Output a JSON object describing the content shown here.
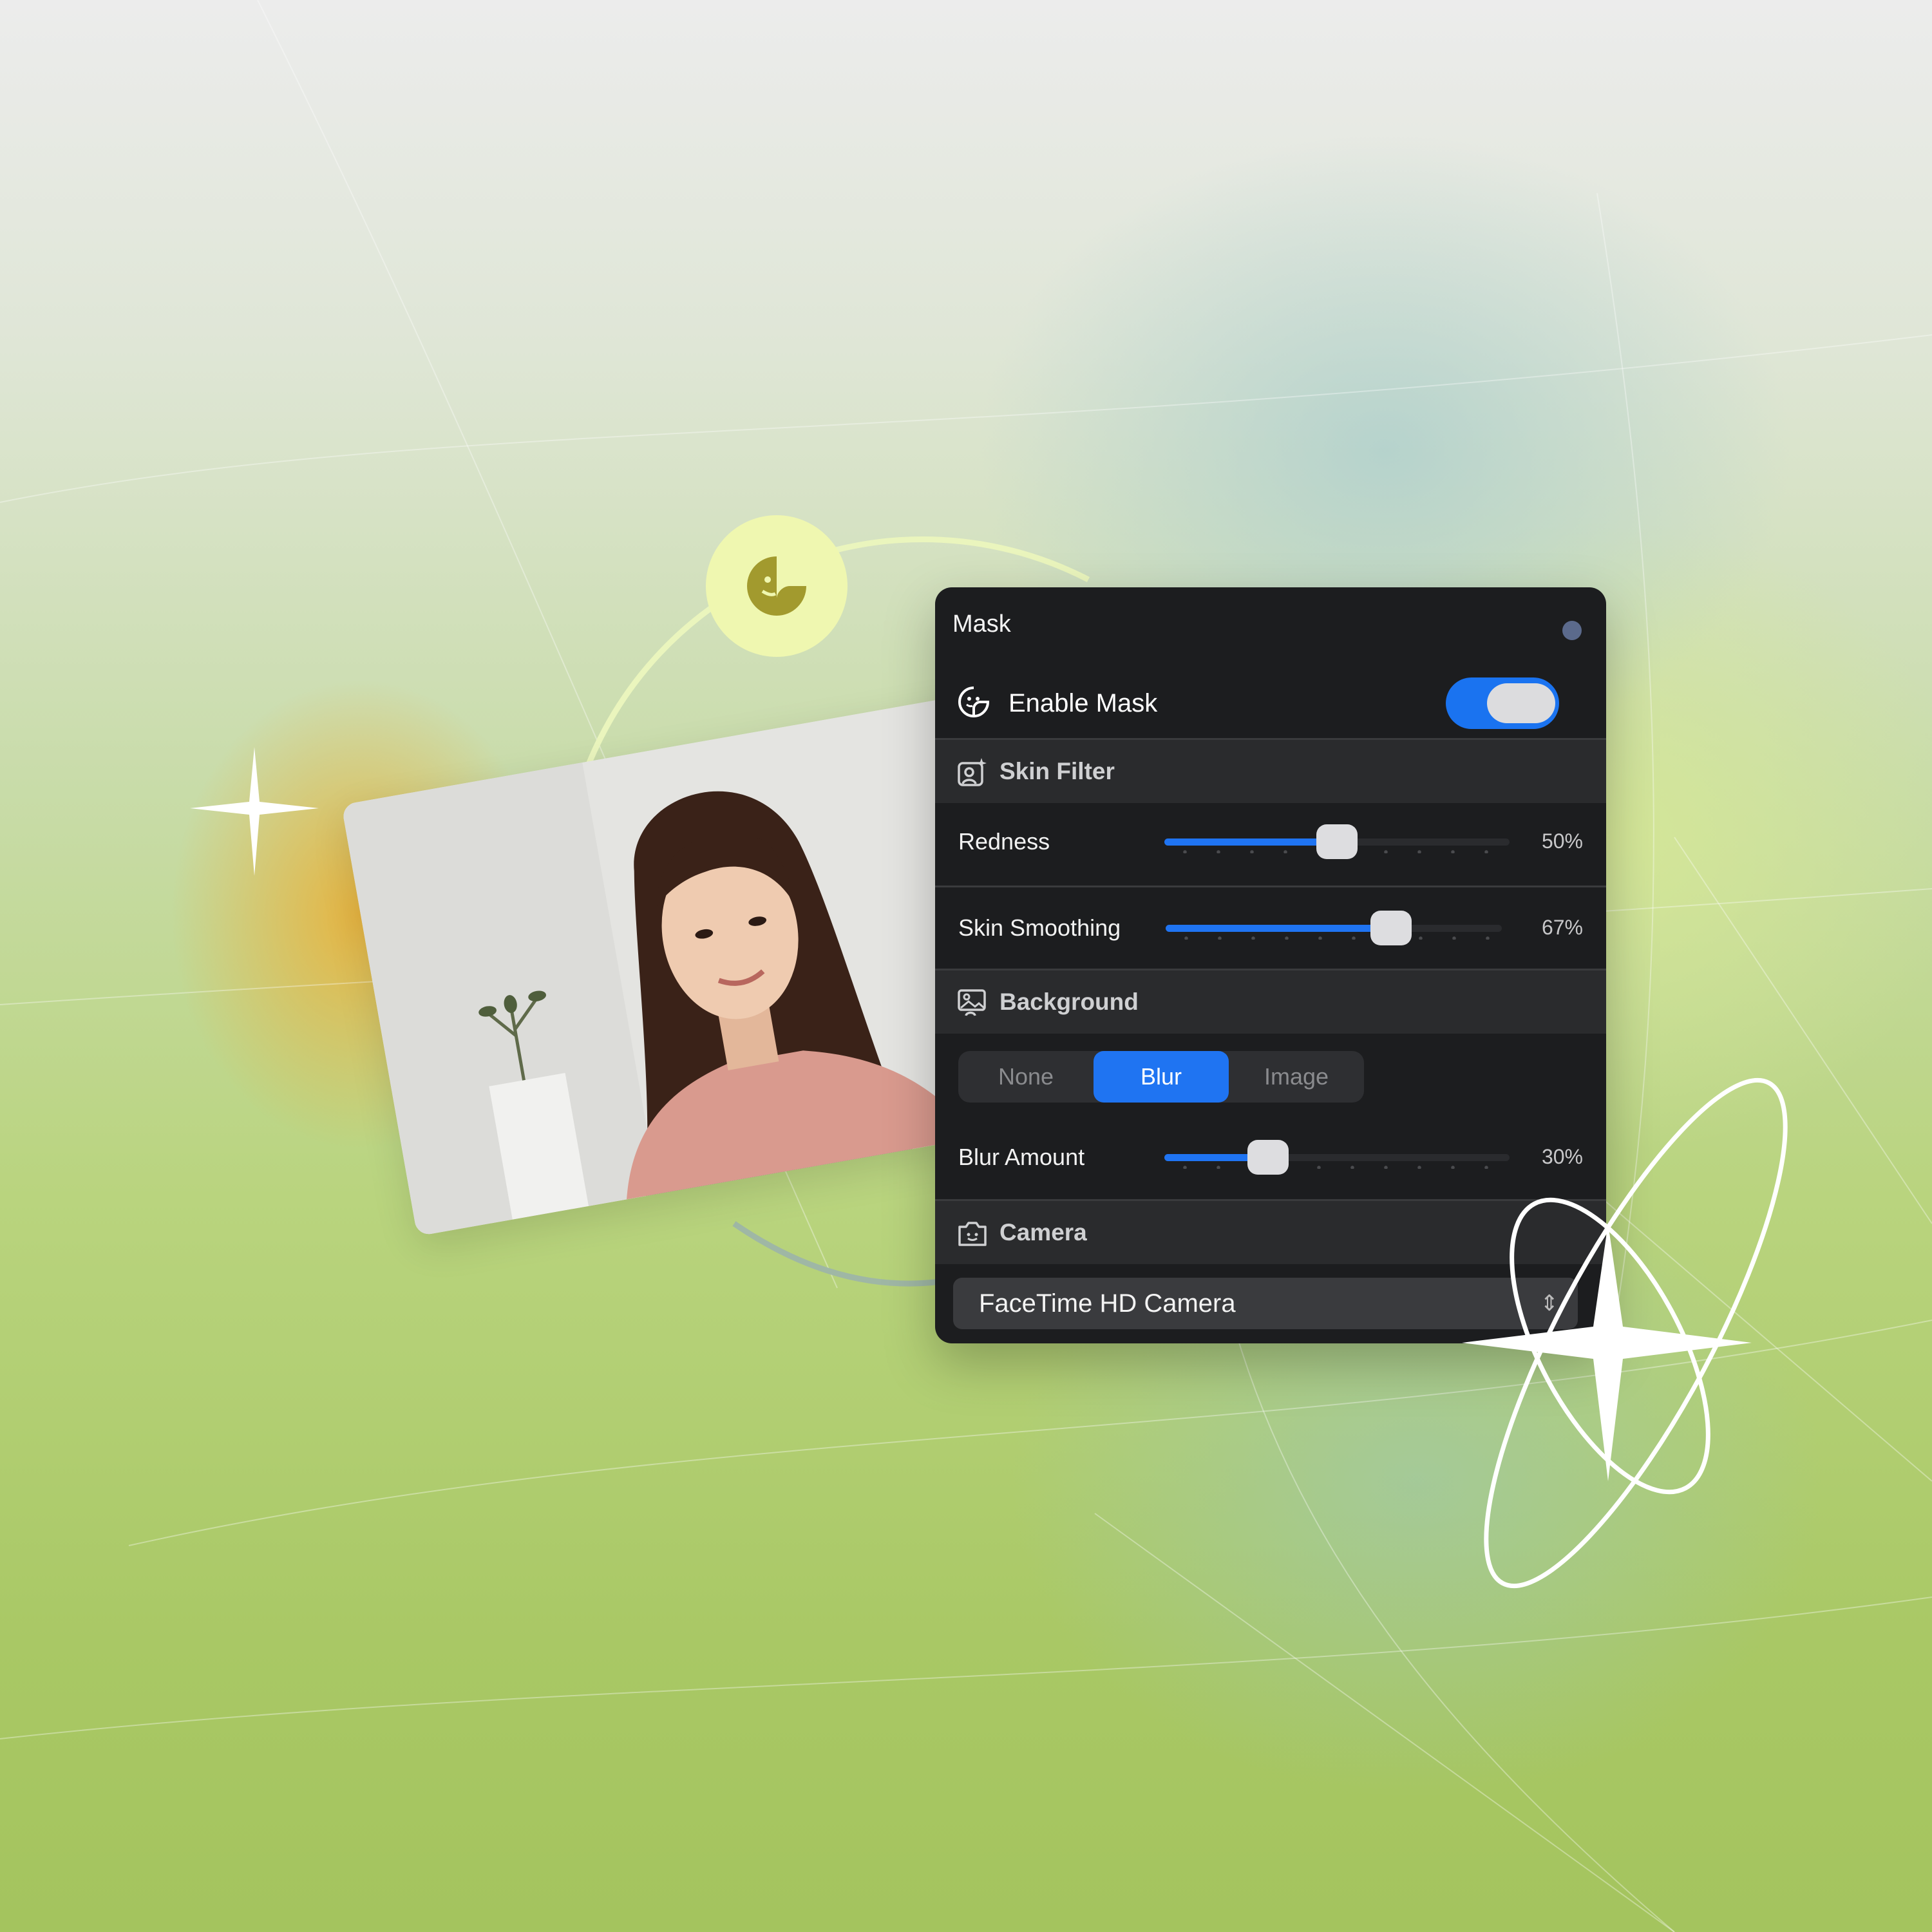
{
  "panel": {
    "title": "Mask",
    "enable_label": "Enable Mask",
    "enable_on": true
  },
  "skin_filter": {
    "heading": "Skin Filter",
    "redness": {
      "label": "Redness",
      "value": 50,
      "display": "50%"
    },
    "smoothing": {
      "label": "Skin Smoothing",
      "value": 67,
      "display": "67%"
    }
  },
  "background": {
    "heading": "Background",
    "options": [
      "None",
      "Blur",
      "Image"
    ],
    "selected": "Blur",
    "blur": {
      "label": "Blur Amount",
      "value": 30,
      "display": "30%"
    }
  },
  "camera": {
    "heading": "Camera",
    "selected": "FaceTime HD Camera"
  },
  "colors": {
    "accent": "#1f74f2",
    "panel_bg": "#1c1d1f",
    "bubble": "#eff7b0",
    "mask_icon": "#a29a2e"
  },
  "icons": [
    "mask-icon",
    "skin-filter-icon",
    "background-icon",
    "camera-icon",
    "chevron-updown-icon",
    "sparkle-icon"
  ]
}
